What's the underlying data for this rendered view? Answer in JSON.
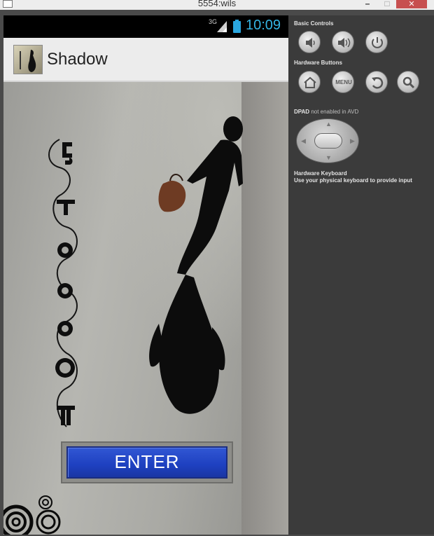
{
  "window": {
    "title": "5554:wils",
    "minimize_glyph": "–",
    "maximize_glyph": "□",
    "close_glyph": "✕"
  },
  "status_bar": {
    "network": "3G",
    "time": "10:09",
    "icons": [
      "signal-icon",
      "battery-icon"
    ]
  },
  "action_bar": {
    "app_title": "Shadow",
    "app_icon": "shadow-app-icon"
  },
  "main": {
    "enter_label": "ENTER",
    "title_art": "decorative-ethiopic-title-icon"
  },
  "controls": {
    "basic_controls_label": "Basic Controls",
    "basic_buttons": [
      {
        "name": "volume-down-button",
        "icon": "volume-down-icon"
      },
      {
        "name": "volume-up-button",
        "icon": "volume-up-icon"
      },
      {
        "name": "power-button",
        "icon": "power-icon"
      }
    ],
    "hardware_buttons_label": "Hardware Buttons",
    "hardware_buttons": [
      {
        "name": "home-button",
        "icon": "home-icon"
      },
      {
        "name": "menu-button",
        "label": "MENU"
      },
      {
        "name": "back-button",
        "icon": "back-icon"
      },
      {
        "name": "search-button",
        "icon": "search-icon"
      }
    ],
    "dpad_label": "DPAD",
    "dpad_note": "not enabled in AVD",
    "keyboard_title": "Hardware Keyboard",
    "keyboard_desc": "Use your physical keyboard to provide input"
  }
}
